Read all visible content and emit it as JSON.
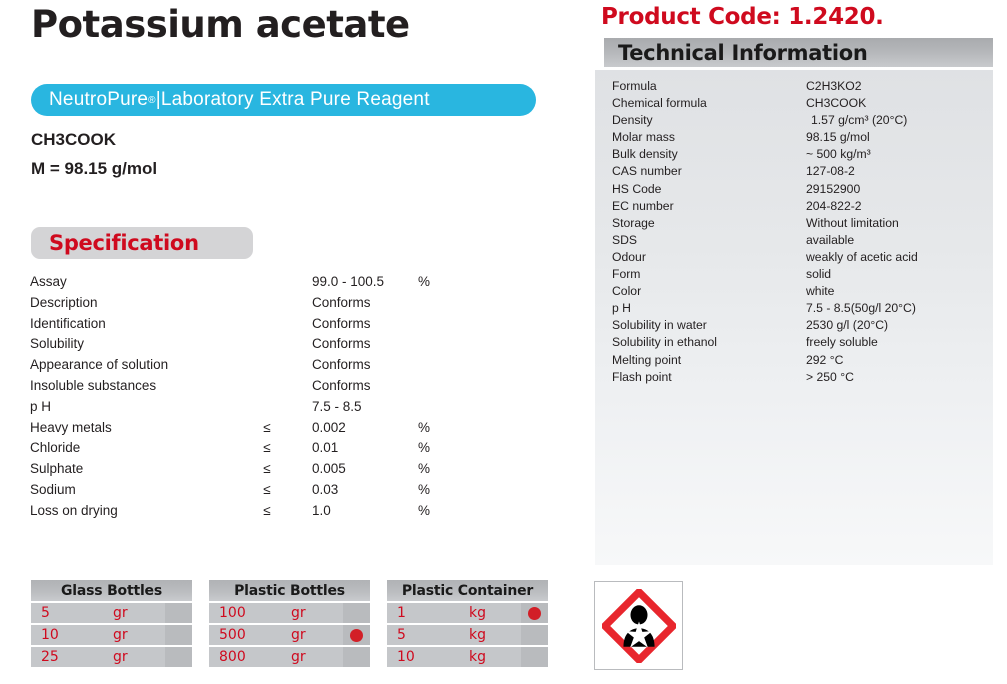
{
  "product": {
    "title": "Potassium acetate",
    "grade_badge": "NeutroPure®|Laboratory Extra Pure Reagent",
    "grade_brand": "NeutroPure",
    "grade_reg": "®",
    "grade_rest": "|Laboratory Extra Pure Reagent",
    "chemical_formula": "CH3COOK",
    "molar_mass": "M = 98.15 g/mol",
    "product_code": "Product Code: 1.2420."
  },
  "specification": {
    "heading": "Specification",
    "rows": [
      {
        "name": "Assay",
        "op": "",
        "value": "99.0 - 100.5",
        "unit": "%"
      },
      {
        "name": "Description",
        "op": "",
        "value": "Conforms",
        "unit": ""
      },
      {
        "name": "Identification",
        "op": "",
        "value": "Conforms",
        "unit": ""
      },
      {
        "name": "Solubility",
        "op": "",
        "value": "Conforms",
        "unit": ""
      },
      {
        "name": "Appearance of solution",
        "op": "",
        "value": "Conforms",
        "unit": ""
      },
      {
        "name": "Insoluble substances",
        "op": "",
        "value": "Conforms",
        "unit": ""
      },
      {
        "name": "p H",
        "op": "",
        "value": "7.5  - 8.5",
        "unit": ""
      },
      {
        "name": "Heavy metals",
        "op": "≤",
        "value": "0.002",
        "unit": "%"
      },
      {
        "name": "Chloride",
        "op": "≤",
        "value": "0.01",
        "unit": "%"
      },
      {
        "name": "Sulphate",
        "op": "≤",
        "value": "0.005",
        "unit": "%"
      },
      {
        "name": "Sodium",
        "op": "≤",
        "value": "0.03",
        "unit": "%"
      },
      {
        "name": "Loss on drying",
        "op": "≤",
        "value": "1.0",
        "unit": "%"
      }
    ]
  },
  "technical_information": {
    "heading": "Technical Information",
    "rows": [
      {
        "label": "Formula",
        "value": "C2H3KO2"
      },
      {
        "label": "Chemical formula",
        "value": "CH3COOK"
      },
      {
        "label": "Density",
        "value": "1.57 g/cm³ (20°C)"
      },
      {
        "label": "Molar mass",
        "value": "98.15 g/mol"
      },
      {
        "label": "Bulk density",
        "value": "~ 500 kg/m³"
      },
      {
        "label": "CAS number",
        "value": "127-08-2"
      },
      {
        "label": "HS Code",
        "value": "29152900"
      },
      {
        "label": "EC number",
        "value": "204-822-2"
      },
      {
        "label": "Storage",
        "value": "Without limitation"
      },
      {
        "label": "SDS",
        "value": "available"
      },
      {
        "label": "Odour",
        "value": "weakly of acetic acid"
      },
      {
        "label": "Form",
        "value": "solid"
      },
      {
        "label": "Color",
        "value": "white"
      },
      {
        "label": "p H",
        "value": "7.5 - 8.5(50g/l 20°C)"
      },
      {
        "label": "Solubility in water",
        "value": "2530 g/l (20°C)"
      },
      {
        "label": "Solubility in ethanol",
        "value": "freely soluble"
      },
      {
        "label": "Melting point",
        "value": "292 °C"
      },
      {
        "label": "Flash point",
        "value": "> 250 °C"
      }
    ]
  },
  "packaging": [
    {
      "title": "Glass Bottles",
      "rows": [
        {
          "amount": "5",
          "unit": "gr",
          "marked": false
        },
        {
          "amount": "10",
          "unit": "gr",
          "marked": false
        },
        {
          "amount": "25",
          "unit": "gr",
          "marked": false
        }
      ]
    },
    {
      "title": "Plastic Bottles",
      "rows": [
        {
          "amount": "100",
          "unit": "gr",
          "marked": false
        },
        {
          "amount": "500",
          "unit": "gr",
          "marked": true
        },
        {
          "amount": "800",
          "unit": "gr",
          "marked": false
        }
      ]
    },
    {
      "title": "Plastic Container",
      "rows": [
        {
          "amount": "1",
          "unit": "kg",
          "marked": true
        },
        {
          "amount": "5",
          "unit": "kg",
          "marked": false
        },
        {
          "amount": "10",
          "unit": "kg",
          "marked": false
        }
      ]
    }
  ],
  "hazard_pictogram": {
    "name": "ghs08-health-hazard",
    "description": "Health hazard pictogram"
  },
  "colors": {
    "accent_red": "#cf0a1e",
    "badge_blue": "#29b6e0",
    "panel_gray": "#c5c7ca",
    "text_dark": "#231f20"
  }
}
